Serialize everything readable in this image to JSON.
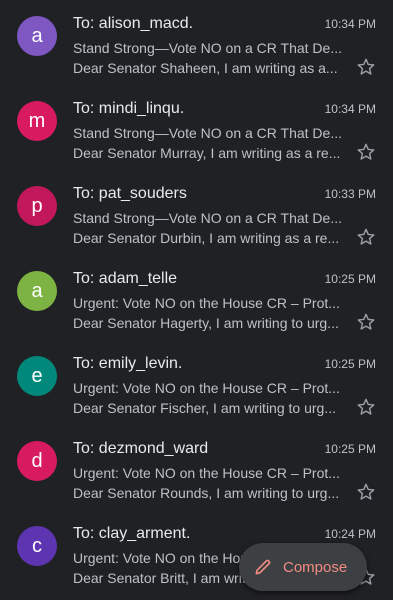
{
  "colors": {
    "background": "#202124",
    "compose_accent": "#f28b82"
  },
  "emails": [
    {
      "initial": "a",
      "avatar_color": "#7e57c2",
      "to": "To: alison_macd.",
      "time": "10:34 PM",
      "subject": "Stand Strong—Vote NO on a CR That De...",
      "snippet": "Dear Senator Shaheen, I am writing as a...",
      "star_icon": "star-outline-icon"
    },
    {
      "initial": "m",
      "avatar_color": "#d81b60",
      "to": "To: mindi_linqu.",
      "time": "10:34 PM",
      "subject": "Stand Strong—Vote NO on a CR That De...",
      "snippet": "Dear Senator Murray, I am writing as a re...",
      "star_icon": "star-outline-icon"
    },
    {
      "initial": "p",
      "avatar_color": "#c2185b",
      "to": "To: pat_souders",
      "time": "10:33 PM",
      "subject": "Stand Strong—Vote NO on a CR That De...",
      "snippet": "Dear Senator Durbin, I am writing as a re...",
      "star_icon": "star-outline-icon"
    },
    {
      "initial": "a",
      "avatar_color": "#7cb342",
      "to": "To: adam_telle",
      "time": "10:25 PM",
      "subject": "Urgent: Vote NO on the House CR – Prot...",
      "snippet": "Dear Senator Hagerty, I am writing to urg...",
      "star_icon": "star-outline-icon"
    },
    {
      "initial": "e",
      "avatar_color": "#00897b",
      "to": "To: emily_levin.",
      "time": "10:25 PM",
      "subject": "Urgent: Vote NO on the House CR – Prot...",
      "snippet": "Dear Senator Fischer, I am writing to urg...",
      "star_icon": "star-outline-icon"
    },
    {
      "initial": "d",
      "avatar_color": "#d81b60",
      "to": "To: dezmond_ward",
      "time": "10:25 PM",
      "subject": "Urgent: Vote NO on the House CR – Prot...",
      "snippet": "Dear Senator Rounds, I am writing to urg...",
      "star_icon": "star-outline-icon"
    },
    {
      "initial": "c",
      "avatar_color": "#5e35b1",
      "to": "To: clay_arment.",
      "time": "10:24 PM",
      "subject": "Urgent: Vote NO on the House CR – Prot...",
      "snippet": "Dear Senator Britt, I am writing to urge...",
      "star_icon": "star-outline-icon"
    }
  ],
  "compose": {
    "label": "Compose",
    "icon": "pencil-icon"
  }
}
